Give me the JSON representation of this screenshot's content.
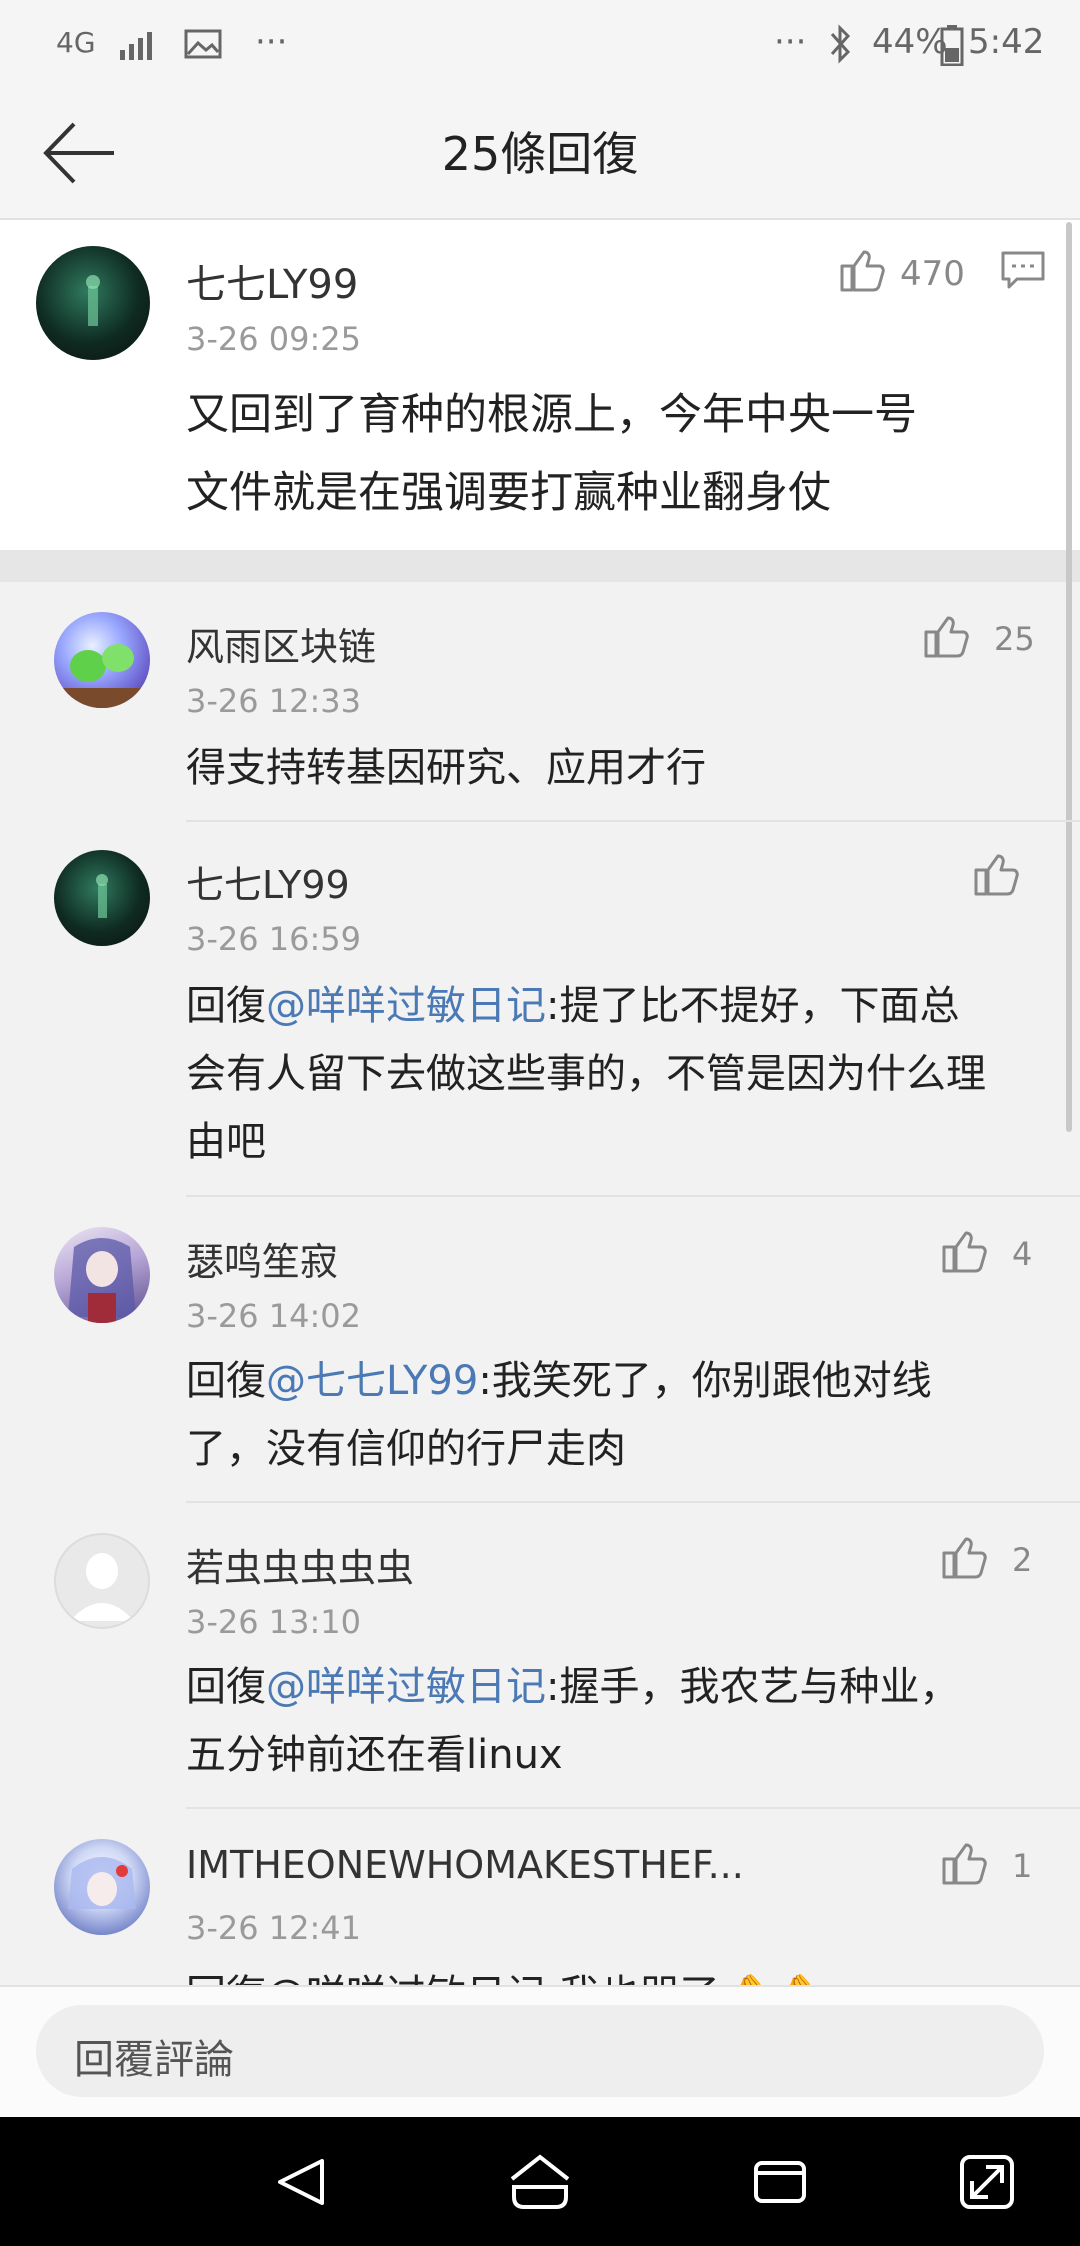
{
  "status_bar": {
    "left": [
      "4G",
      "📶",
      "🖼",
      "···"
    ],
    "dots": "···",
    "battery": "44%",
    "time": "5:42"
  },
  "header": {
    "title": "25條回復"
  },
  "main_comment": {
    "user": "七七LY99",
    "time": "3-26 09:25",
    "likes": "470",
    "text_line1": "又回到了育种的根源上，今年中央一号",
    "text_line2": "文件就是在强调要打赢种业翻身仗"
  },
  "replies": [
    {
      "user": "风雨区块链",
      "time": "3-26 12:33",
      "likes": "25",
      "text": "得支持转基因研究、应用才行"
    },
    {
      "user": "七七LY99",
      "time": "3-26 16:59",
      "likes": "",
      "prefix": "回復",
      "mention": "@咩咩过敏日记",
      "line1": ":提了比不提好，下面总",
      "line2": "会有人留下去做这些事的，不管是因为什么理",
      "line3": "由吧"
    },
    {
      "user": "瑟鸣笙寂",
      "time": "3-26 14:02",
      "likes": "4",
      "prefix": "回復",
      "mention": "@七七LY99",
      "line1": ":我笑死了，你别跟他对线",
      "line2": "了，没有信仰的行尸走肉"
    },
    {
      "user": "若虫虫虫虫虫",
      "time": "3-26 13:10",
      "likes": "2",
      "prefix": "回復",
      "mention": "@咩咩过敏日记",
      "line1": ":握手，我农艺与种业，",
      "line2": "五分钟前还在看linux"
    },
    {
      "user": "IMTHEONEWHOMAKESTHEF...",
      "time": "3-26 12:41",
      "likes": "1",
      "partial": "回復@咩咩过敏日记:我也哭了🤌🤌"
    }
  ],
  "input": {
    "placeholder": "回覆評論"
  },
  "colors": {
    "mention": "#4a79b5",
    "background": "#f2f2f2"
  }
}
